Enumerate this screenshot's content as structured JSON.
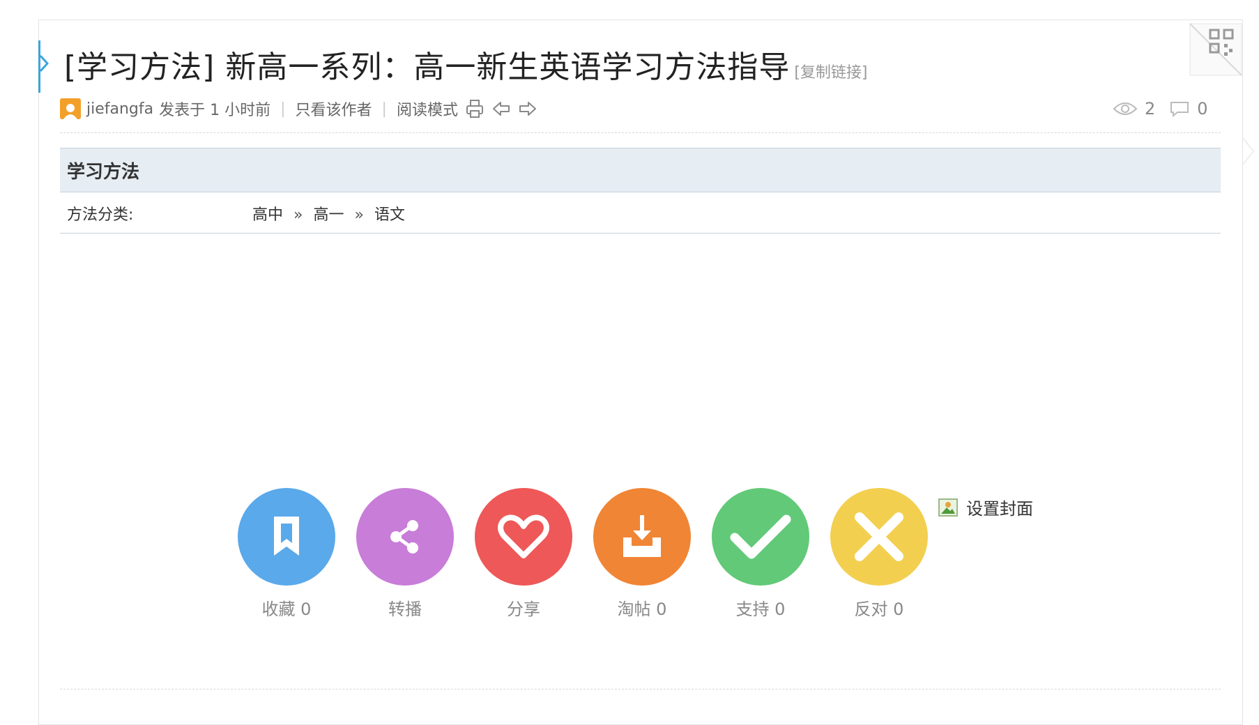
{
  "post": {
    "title": "[学习方法] 新高一系列：高一新生英语学习方法指导",
    "copy_link": "[复制链接]"
  },
  "meta": {
    "author": "jiefangfa",
    "posted": "发表于 1 小时前",
    "only_author": "只看该作者",
    "reading_mode": "阅读模式",
    "views": "2",
    "replies": "0"
  },
  "table": {
    "header": "学习方法",
    "label": "方法分类:",
    "breadcrumb": [
      "高中",
      "高一",
      "语文"
    ],
    "separator": "»"
  },
  "actions": [
    {
      "label": "收藏 0",
      "color": "#5aa9ea",
      "icon": "bookmark-icon"
    },
    {
      "label": "转播",
      "color": "#c87dd8",
      "icon": "share-nodes-icon"
    },
    {
      "label": "分享",
      "color": "#ee5858",
      "icon": "heart-icon"
    },
    {
      "label": "淘帖 0",
      "color": "#f08535",
      "icon": "download-tray-icon"
    },
    {
      "label": "支持 0",
      "color": "#62c978",
      "icon": "check-icon"
    },
    {
      "label": "反对 0",
      "color": "#f3cf50",
      "icon": "cross-icon"
    }
  ],
  "cover": {
    "label": "设置封面",
    "icon": "image-icon"
  },
  "colors": {
    "accent": "#3aa4dc",
    "header_bg": "#e6edf3"
  }
}
